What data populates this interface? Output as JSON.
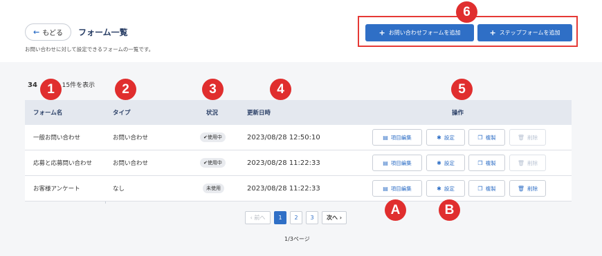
{
  "header": {
    "back_label": "もどる",
    "title": "フォーム一覧",
    "subtitle": "お問い合わせに対して設定できるフォームの一覧です。",
    "add_contact_label": "お問い合わせフォームを追加",
    "add_step_label": "ステップフォームを追加"
  },
  "summary": {
    "total": "34",
    "shown": "15件を表示"
  },
  "columns": [
    "フォーム名",
    "タイプ",
    "状況",
    "更新日時",
    "操作"
  ],
  "rows": [
    {
      "name": "一般お問い合わせ",
      "type": "お問い合わせ",
      "status": "✔使用中",
      "updated": "2023/08/28 12:50:10"
    },
    {
      "name": "応募と応募問い合わせ",
      "type": "お問い合わせ",
      "status": "✔使用中",
      "updated": "2023/08/28 11:22:33"
    },
    {
      "name": "お客様アンケート",
      "type": "なし",
      "status": "未使用",
      "updated": "2023/08/28 11:22:33"
    }
  ],
  "actions": {
    "edit": "項目編集",
    "settings": "設定",
    "copy": "複製",
    "delete": "削除"
  },
  "pagination": {
    "prev": "‹ 前へ",
    "pages": [
      "1",
      "2",
      "3"
    ],
    "next": "次へ ›",
    "info": "1/3ページ"
  },
  "markers": [
    "1",
    "2",
    "3",
    "4",
    "5",
    "6",
    "A",
    "B"
  ],
  "colors": {
    "primary": "#2f6fc6",
    "marker": "#e02e2e"
  }
}
